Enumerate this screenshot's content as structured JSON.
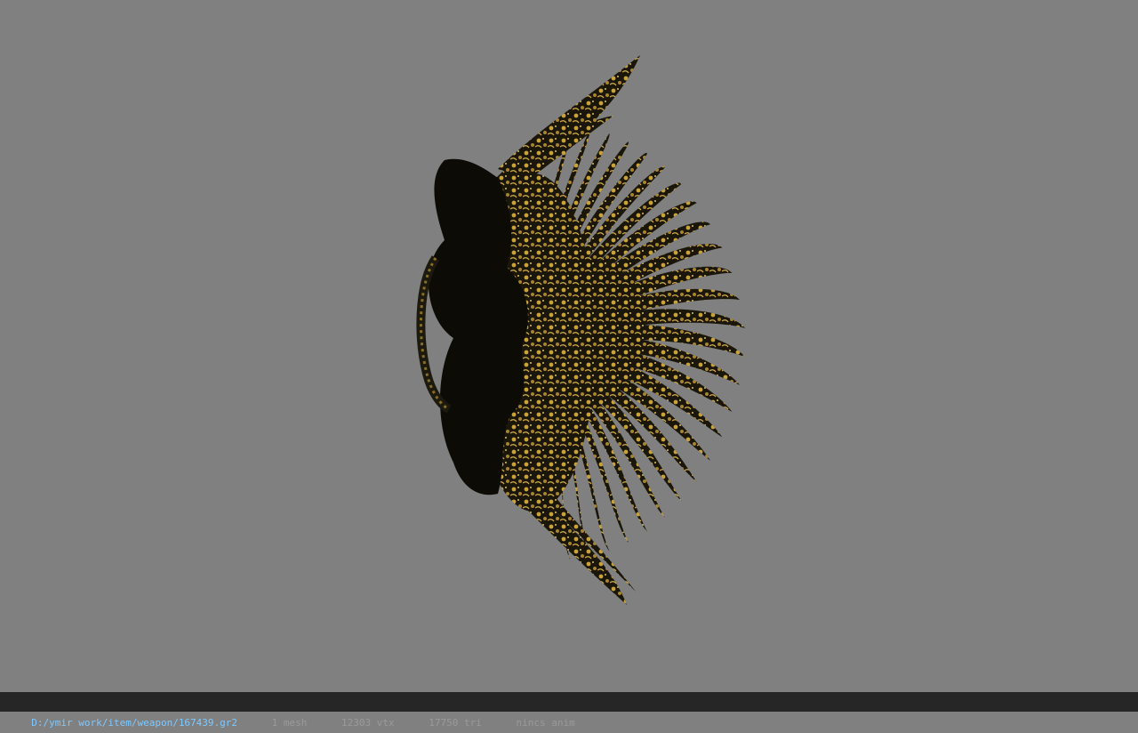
{
  "viewport": {
    "background": "#808080",
    "model": {
      "description_icon": "ornate-fan-weapon-model",
      "gold": "#b8952e",
      "dark": "#141208"
    }
  },
  "status": {
    "path": "D:/ymir work/item/weapon/167439.gr2",
    "meshes": "1 mesh",
    "vertices": "12303 vtx",
    "triangles": "17750 tri",
    "anim": "nincs anim",
    "separator": "|",
    "colors": {
      "background": "#262626",
      "path": "#7ec8ff",
      "text": "#9a9a9a"
    }
  }
}
